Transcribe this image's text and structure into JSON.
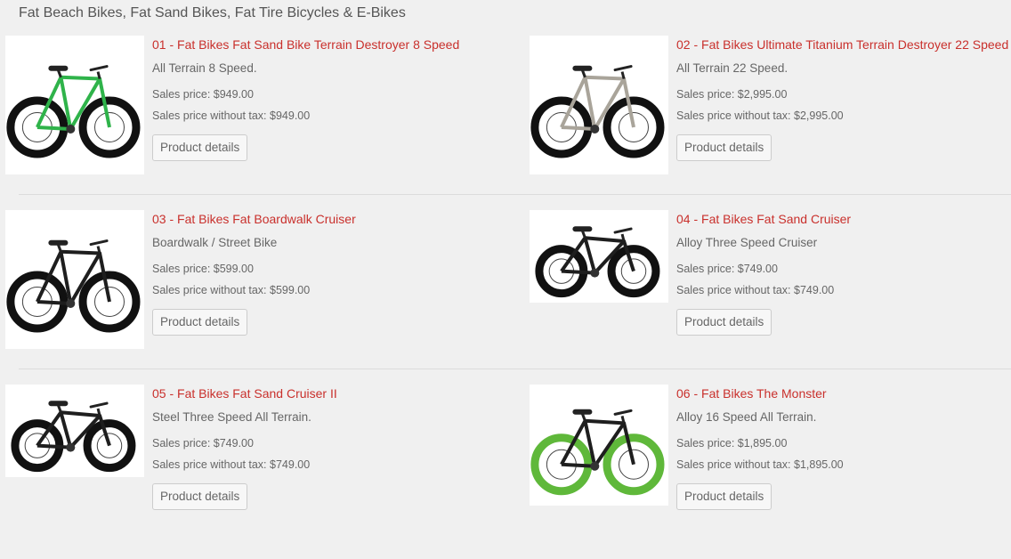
{
  "category": {
    "title": "Fat Beach Bikes, Fat Sand Bikes, Fat Tire Bicycles & E-Bikes"
  },
  "products": [
    {
      "name": "01 - Fat Bikes Fat Sand Bike Terrain Destroyer 8 Speed",
      "description": "All Terrain 8 Speed.",
      "sales_price": "Sales price: $949.00",
      "sales_price_no_tax": "Sales price without tax: $949.00",
      "button": "Product details",
      "frame_color": "#2fb34a",
      "tire_color": "#111111"
    },
    {
      "name": "02 - Fat Bikes Ultimate Titanium Terrain Destroyer 22 Speed",
      "description": "All Terrain 22 Speed.",
      "sales_price": "Sales price: $2,995.00",
      "sales_price_no_tax": "Sales price without tax: $2,995.00",
      "button": "Product details",
      "frame_color": "#a9a49a",
      "tire_color": "#111111"
    },
    {
      "name": "03 - Fat Bikes Fat Boardwalk Cruiser",
      "description": "Boardwalk / Street Bike",
      "sales_price": "Sales price: $599.00",
      "sales_price_no_tax": "Sales price without tax: $599.00",
      "button": "Product details",
      "frame_color": "#1e1e1e",
      "tire_color": "#111111"
    },
    {
      "name": "04 - Fat Bikes Fat Sand Cruiser",
      "description": "Alloy Three Speed Cruiser",
      "sales_price": "Sales price: $749.00",
      "sales_price_no_tax": "Sales price without tax: $749.00",
      "button": "Product details",
      "frame_color": "#1e1e1e",
      "tire_color": "#111111"
    },
    {
      "name": "05 - Fat Bikes Fat Sand Cruiser II",
      "description": "Steel Three Speed All Terrain.",
      "sales_price": "Sales price: $749.00",
      "sales_price_no_tax": "Sales price without tax: $749.00",
      "button": "Product details",
      "frame_color": "#1e1e1e",
      "tire_color": "#111111"
    },
    {
      "name": "06 - Fat Bikes The Monster",
      "description": "Alloy 16 Speed All Terrain.",
      "sales_price": "Sales price: $1,895.00",
      "sales_price_no_tax": "Sales price without tax: $1,895.00",
      "button": "Product details",
      "frame_color": "#1e1e1e",
      "tire_color": "#5fb83a"
    }
  ]
}
